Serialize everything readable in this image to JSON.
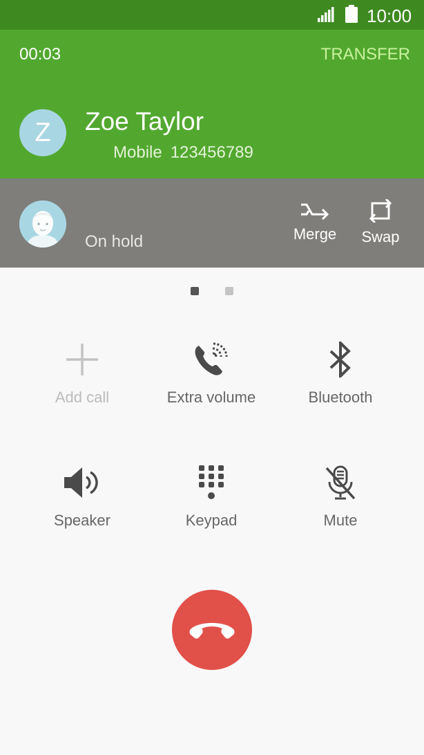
{
  "status_bar": {
    "time": "10:00",
    "icons": [
      "signal-icon",
      "battery-icon"
    ]
  },
  "active_call": {
    "timer": "00:03",
    "transfer_label": "TRANSFER",
    "avatar_initial": "Z",
    "name": "Zoe Taylor",
    "number_type": "Mobile",
    "number": "123456789"
  },
  "held_call": {
    "status": "On hold",
    "merge_label": "Merge",
    "swap_label": "Swap"
  },
  "pager": {
    "pages": 2,
    "current": 1
  },
  "controls": {
    "add_call": "Add call",
    "extra_volume": "Extra volume",
    "bluetooth": "Bluetooth",
    "speaker": "Speaker",
    "keypad": "Keypad",
    "mute": "Mute"
  },
  "colors": {
    "status_bar": "#3e8a21",
    "active_call_bg": "#52a82f",
    "transfer_text": "#c9f29f",
    "hold_bg": "#7f7e7b",
    "avatar_bg": "#a9d6e3",
    "end_call": "#e2504a"
  }
}
